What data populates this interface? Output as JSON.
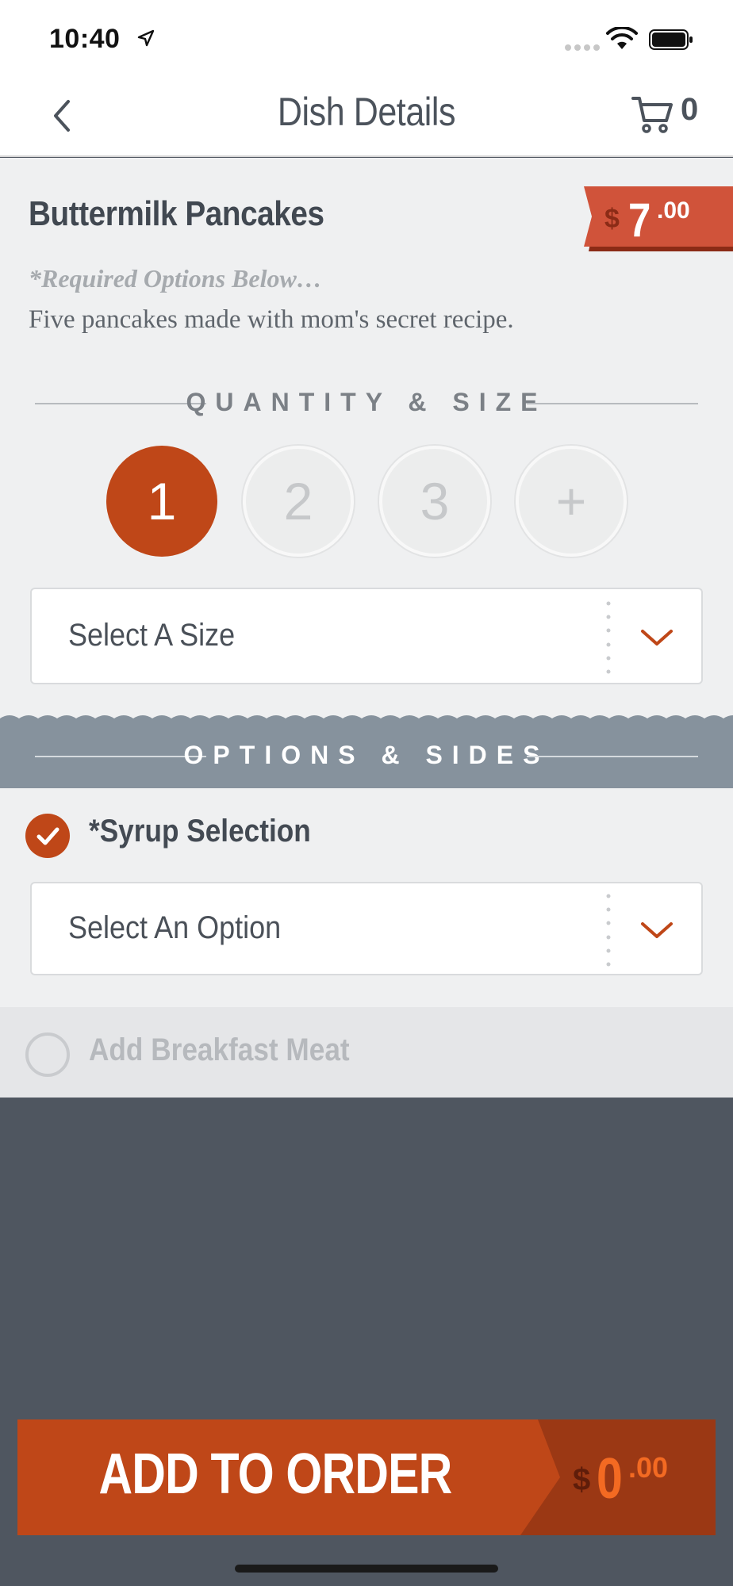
{
  "status_bar": {
    "time": "10:40"
  },
  "nav": {
    "title": "Dish Details",
    "cart_count": "0"
  },
  "dish": {
    "name": "Buttermilk Pancakes",
    "price_currency": "$",
    "price_int": "7",
    "price_dec": ".00",
    "required_note": "*Required Options Below…",
    "description": "Five pancakes made with mom's secret recipe."
  },
  "quantity_section": {
    "label": "QUANTITY & SIZE",
    "options": [
      "1",
      "2",
      "3",
      "+"
    ],
    "selected": "1",
    "size_placeholder": "Select A Size"
  },
  "options_section": {
    "label": "OPTIONS & SIDES",
    "syrup_label": "*Syrup Selection",
    "syrup_checked": true,
    "syrup_placeholder": "Select An Option",
    "meat_label": "Add Breakfast Meat",
    "meat_checked": false
  },
  "add_button": {
    "label": "ADD TO ORDER",
    "price_currency": "$",
    "price_int": "0",
    "price_dec": ".00"
  },
  "colors": {
    "accent": "#bf4718",
    "dark_bg": "#4f5660",
    "band": "#86929d"
  }
}
